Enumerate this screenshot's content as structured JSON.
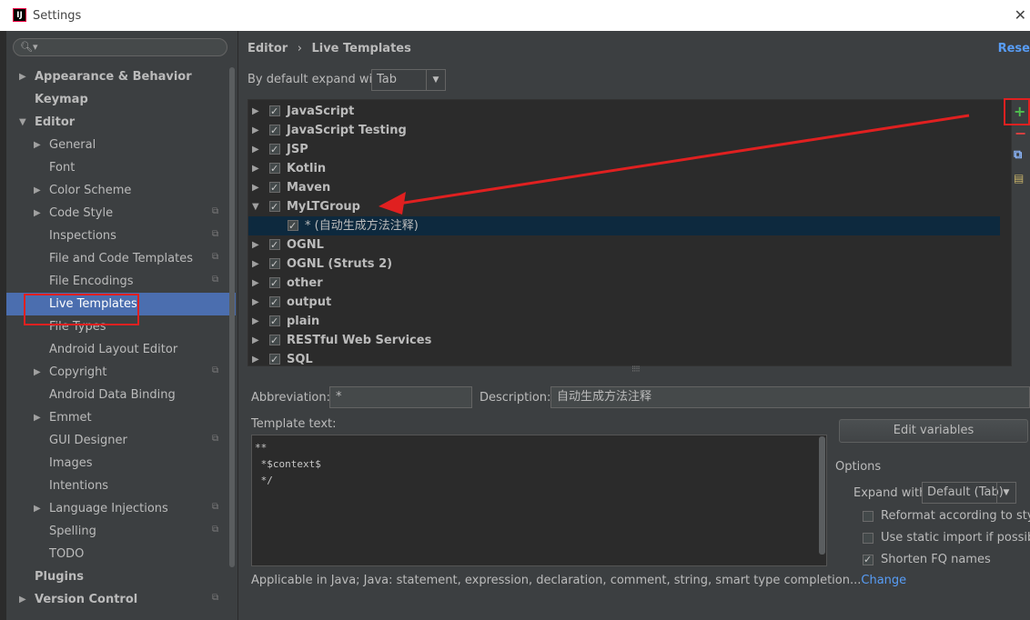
{
  "window": {
    "title": "Settings",
    "app_icon": "IJ"
  },
  "sidebar": {
    "items": [
      {
        "label": "Appearance & Behavior",
        "arrow": "▶",
        "level": 0,
        "bold": true
      },
      {
        "label": "Keymap",
        "arrow": "",
        "level": 0,
        "bold": true
      },
      {
        "label": "Editor",
        "arrow": "▼",
        "level": 0,
        "bold": true
      },
      {
        "label": "General",
        "arrow": "▶",
        "level": 1
      },
      {
        "label": "Font",
        "arrow": "",
        "level": 1
      },
      {
        "label": "Color Scheme",
        "arrow": "▶",
        "level": 1
      },
      {
        "label": "Code Style",
        "arrow": "▶",
        "level": 1,
        "page": true
      },
      {
        "label": "Inspections",
        "arrow": "",
        "level": 1,
        "page": true
      },
      {
        "label": "File and Code Templates",
        "arrow": "",
        "level": 1,
        "page": true
      },
      {
        "label": "File Encodings",
        "arrow": "",
        "level": 1,
        "page": true
      },
      {
        "label": "Live Templates",
        "arrow": "",
        "level": 1,
        "selected": true
      },
      {
        "label": "File Types",
        "arrow": "",
        "level": 1
      },
      {
        "label": "Android Layout Editor",
        "arrow": "",
        "level": 1
      },
      {
        "label": "Copyright",
        "arrow": "▶",
        "level": 1,
        "page": true
      },
      {
        "label": "Android Data Binding",
        "arrow": "",
        "level": 1
      },
      {
        "label": "Emmet",
        "arrow": "▶",
        "level": 1
      },
      {
        "label": "GUI Designer",
        "arrow": "",
        "level": 1,
        "page": true
      },
      {
        "label": "Images",
        "arrow": "",
        "level": 1
      },
      {
        "label": "Intentions",
        "arrow": "",
        "level": 1
      },
      {
        "label": "Language Injections",
        "arrow": "▶",
        "level": 1,
        "page": true
      },
      {
        "label": "Spelling",
        "arrow": "",
        "level": 1,
        "page": true
      },
      {
        "label": "TODO",
        "arrow": "",
        "level": 1
      },
      {
        "label": "Plugins",
        "arrow": "",
        "level": 0,
        "bold": true
      },
      {
        "label": "Version Control",
        "arrow": "▶",
        "level": 0,
        "bold": true,
        "page": true
      }
    ]
  },
  "header": {
    "crumb_parent": "Editor",
    "crumb_sep": "›",
    "crumb_current": "Live Templates",
    "reset": "Rese"
  },
  "expand": {
    "label": "By default expand with",
    "value": "Tab"
  },
  "groups": [
    {
      "name": "JavaScript",
      "arrow": "▶"
    },
    {
      "name": "JavaScript Testing",
      "arrow": "▶"
    },
    {
      "name": "JSP",
      "arrow": "▶"
    },
    {
      "name": "Kotlin",
      "arrow": "▶"
    },
    {
      "name": "Maven",
      "arrow": "▶"
    },
    {
      "name": "MyLTGroup",
      "arrow": "▼"
    },
    {
      "name": "* (自动生成方法注释)",
      "arrow": "",
      "child": true
    },
    {
      "name": "OGNL",
      "arrow": "▶"
    },
    {
      "name": "OGNL (Struts 2)",
      "arrow": "▶"
    },
    {
      "name": "other",
      "arrow": "▶"
    },
    {
      "name": "output",
      "arrow": "▶"
    },
    {
      "name": "plain",
      "arrow": "▶"
    },
    {
      "name": "RESTful Web Services",
      "arrow": "▶"
    },
    {
      "name": "SQL",
      "arrow": "▶"
    }
  ],
  "toolbar": {
    "add": "+",
    "remove": "−",
    "copy_icon": "copy-icon",
    "template_icon": "template-icon"
  },
  "details": {
    "abbreviation_label": "Abbreviation:",
    "abbreviation_value": "*",
    "description_label": "Description:",
    "description_value": "自动生成方法注释",
    "template_text_label": "Template text:",
    "template_lines": [
      "**",
      " *$context$",
      " */"
    ],
    "edit_variables": "Edit variables",
    "applicable": "Applicable in Java; Java: statement, expression, declaration, comment, string, smart type completion...",
    "change": "Change"
  },
  "options": {
    "title": "Options",
    "expand_with_label": "Expand with",
    "expand_with_value": "Default (Tab)",
    "checks": [
      {
        "label": "Reformat according to style",
        "checked": false
      },
      {
        "label": "Use static import if possible",
        "checked": false
      },
      {
        "label": "Shorten FQ names",
        "checked": true
      }
    ]
  },
  "colors": {
    "accent": "#4b6eaf",
    "annotation_red": "#e02020",
    "link": "#589df6",
    "selected_row": "#0d293e"
  }
}
